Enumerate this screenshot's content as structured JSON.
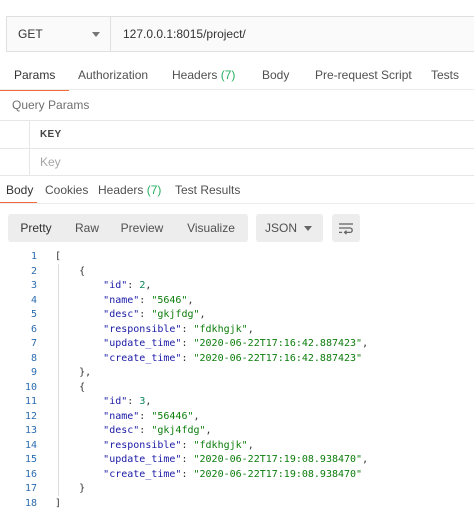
{
  "request": {
    "method": "GET",
    "url": "127.0.0.1:8015/project/"
  },
  "request_tabs": [
    {
      "label": "Params",
      "count": ""
    },
    {
      "label": "Authorization",
      "count": ""
    },
    {
      "label": "Headers",
      "count": "(7)"
    },
    {
      "label": "Body",
      "count": ""
    },
    {
      "label": "Pre-request Script",
      "count": ""
    },
    {
      "label": "Tests",
      "count": ""
    }
  ],
  "query_params": {
    "title": "Query Params",
    "key_header": "KEY",
    "key_placeholder": "Key"
  },
  "response_tabs": [
    {
      "label": "Body",
      "count": ""
    },
    {
      "label": "Cookies",
      "count": ""
    },
    {
      "label": "Headers",
      "count": "(7)"
    },
    {
      "label": "Test Results",
      "count": ""
    }
  ],
  "view_modes": [
    "Pretty",
    "Raw",
    "Preview",
    "Visualize"
  ],
  "format": "JSON",
  "response_body": [
    {
      "id": 2,
      "name": "5646",
      "desc": "gkjfdg",
      "responsible": "fdkhgjk",
      "update_time": "2020-06-22T17:16:42.887423",
      "create_time": "2020-06-22T17:16:42.887423"
    },
    {
      "id": 3,
      "name": "56446",
      "desc": "gkj4fdg",
      "responsible": "fdkhgjk",
      "update_time": "2020-06-22T17:19:08.938470",
      "create_time": "2020-06-22T17:19:08.938470"
    }
  ],
  "colors": {
    "accent": "#f26b3a",
    "count": "#27ae60",
    "json_key": "#1a1aa6",
    "json_string": "#0b7d0b",
    "json_number": "#098658",
    "line_number": "#2b6cb0"
  }
}
